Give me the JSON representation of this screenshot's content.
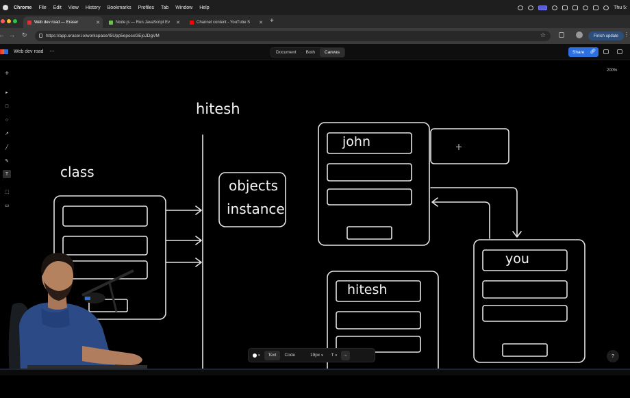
{
  "menubar": {
    "app": "Chrome",
    "items": [
      "File",
      "Edit",
      "View",
      "History",
      "Bookmarks",
      "Profiles",
      "Tab",
      "Window",
      "Help"
    ],
    "clock": "Thu 5:"
  },
  "tabs": [
    {
      "label": "Web dev road — Eraser",
      "favicon_color": "#e0302f"
    },
    {
      "label": "Node.js — Run JavaScript Ev",
      "favicon_color": "#6cc24a"
    },
    {
      "label": "Channel content - YouTube S",
      "favicon_color": "#ff0000"
    }
  ],
  "address": {
    "url": "https://app.eraser.io/workspace/I5Upp5eposxGEjoJDgVM",
    "finish_update": "Finish update"
  },
  "app": {
    "file_name": "Web dev road",
    "file_menu": "⋯",
    "view_modes": [
      "Document",
      "Both",
      "Canvas"
    ],
    "selected_view": "Canvas",
    "share": "Share",
    "zoom": "200%"
  },
  "canvas": {
    "labels": {
      "hitesh_top": "hitesh",
      "class": "class",
      "objects": "objects",
      "instance": "instance",
      "john": "john",
      "you": "you",
      "hitesh_card": "hitesh"
    }
  },
  "bottom_toolbar": {
    "text": "Text",
    "code": "Code",
    "font_size": "19px",
    "text_style": "T",
    "more": "⋯"
  },
  "help": "?",
  "colors": {
    "canvas_bg": "#000000",
    "stroke": "#e6e6e6",
    "accent": "#2c6fe0"
  }
}
